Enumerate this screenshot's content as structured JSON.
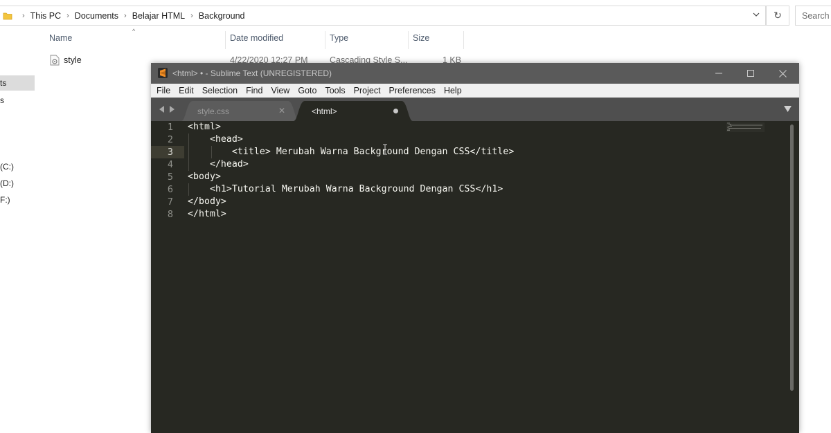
{
  "explorer": {
    "breadcrumb": [
      "This PC",
      "Documents",
      "Belajar HTML",
      "Background"
    ],
    "search_placeholder": "Search Ba",
    "nav_items": [
      {
        "label": "ts",
        "selected": true
      },
      {
        "label": "s",
        "selected": false
      },
      {
        "label": "(C:)",
        "selected": false
      },
      {
        "label": "(D:)",
        "selected": false
      },
      {
        "label": "F:)",
        "selected": false
      }
    ],
    "columns": [
      "Name",
      "Date modified",
      "Type",
      "Size"
    ],
    "files": [
      {
        "name": "style",
        "date_modified": "4/22/2020 12:27 PM",
        "type": "Cascading Style S...",
        "size": "1 KB"
      }
    ]
  },
  "sublime": {
    "title": "<html> • - Sublime Text (UNREGISTERED)",
    "menu": [
      "File",
      "Edit",
      "Selection",
      "Find",
      "View",
      "Goto",
      "Tools",
      "Project",
      "Preferences",
      "Help"
    ],
    "tabs": [
      {
        "label": "style.css",
        "active": false,
        "dirty": false
      },
      {
        "label": "<html>",
        "active": true,
        "dirty": true
      }
    ],
    "current_line": 3,
    "lines": [
      "<html>",
      "    <head>",
      "        <title> Merubah Warna Background Dengan CSS</title>",
      "    </head>",
      "<body>",
      "    <h1>Tutorial Merubah Warna Background Dengan CSS</h1>",
      "</body>",
      "</html>"
    ],
    "line_numbers": [
      "1",
      "2",
      "3",
      "4",
      "5",
      "6",
      "7",
      "8"
    ],
    "colors": {
      "editor_bg": "#272822",
      "text": "#f8f8f2",
      "titlebar": "#5a5a5a",
      "tabbar": "#4f4f4f",
      "accent_icon": "#f08d24"
    }
  }
}
